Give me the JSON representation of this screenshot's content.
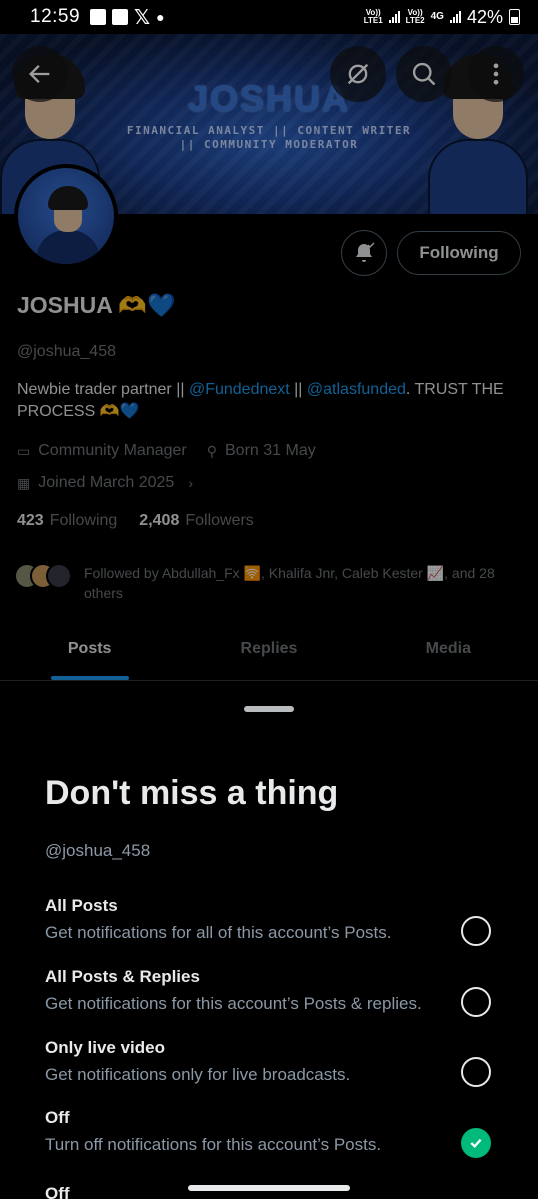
{
  "status_bar": {
    "time": "12:59",
    "left_icons": [
      "gallery-icon",
      "check-box-icon",
      "x-logo-icon",
      "dot-icon"
    ],
    "sim1": "Vo))\nLTE1",
    "sim2": "Vo))\nLTE2",
    "network": "4G",
    "battery": "42%"
  },
  "banner": {
    "title": "JOSHUA",
    "subtitle_line1": "FINANCIAL ANALYST || CONTENT WRITER",
    "subtitle_line2": "|| COMMUNITY MODERATOR"
  },
  "top_bar": {
    "back_icon": "back-arrow-icon",
    "grok_icon": "grok-icon",
    "search_icon": "search-icon",
    "more_icon": "more-vertical-icon"
  },
  "profile": {
    "name": "JOSHUA 🫶💙",
    "handle": "@joshua_458",
    "bio_prefix": "Newbie trader  partner || ",
    "bio_link1": "@Fundednext",
    "bio_sep": " || ",
    "bio_link2": "@atlasfunded",
    "bio_suffix": ".   TRUST THE PROCESS 🫶💙",
    "category": "Community Manager",
    "born": "Born 31 May",
    "joined": "Joined March 2025",
    "following_count": "423",
    "following_label": "Following",
    "followers_count": "2,408",
    "followers_label": "Followers",
    "followed_by": "Followed by Abdullah_Fx 🛜, Khalifa Jnr, Caleb Kester 📈, and 28 others",
    "follow_button": "Following"
  },
  "tabs": [
    {
      "label": "Posts",
      "active": true
    },
    {
      "label": "Replies",
      "active": false
    },
    {
      "label": "Media",
      "active": false
    }
  ],
  "sheet": {
    "title": "Don't miss a thing",
    "handle": "@joshua_458",
    "options": [
      {
        "title": "All Posts",
        "desc": "Get notifications for all of this account’s Posts.",
        "selected": false
      },
      {
        "title": "All Posts & Replies",
        "desc": "Get notifications for this account’s Posts & replies.",
        "selected": false
      },
      {
        "title": "Only live video",
        "desc": "Get notifications only for live broadcasts.",
        "selected": false
      },
      {
        "title": "Off",
        "desc": "Turn off notifications for this account’s Posts.",
        "selected": true
      }
    ],
    "cut_off_label": "Off"
  },
  "colors": {
    "accent": "#1d9bf0",
    "success": "#00ba7c",
    "muted": "#71767b"
  }
}
